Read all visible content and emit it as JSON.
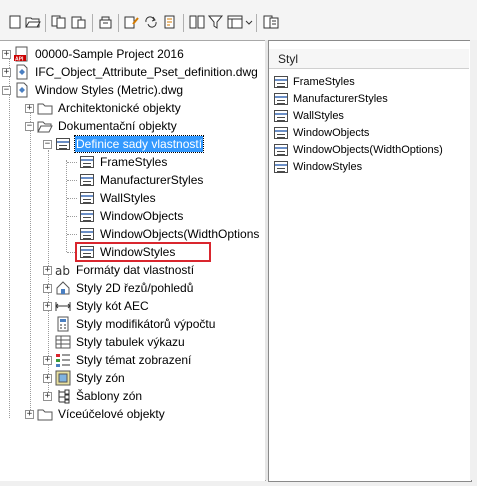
{
  "toolbar": {
    "buttons": [
      {
        "name": "new-document-icon",
        "glyph": "□"
      },
      {
        "name": "open-folder-icon",
        "glyph": "▱"
      },
      {
        "name": "copy-icon",
        "glyph": "❐"
      },
      {
        "name": "paste-icon",
        "glyph": "⎘"
      },
      {
        "name": "purge-icon",
        "glyph": "⚑"
      },
      {
        "name": "edit-style-icon",
        "glyph": "✎"
      },
      {
        "name": "synchronize-icon",
        "glyph": "↻"
      },
      {
        "name": "style-properties-icon",
        "glyph": "☰"
      },
      {
        "name": "compare-icon",
        "glyph": "▤"
      },
      {
        "name": "filter-icon",
        "glyph": "▽"
      },
      {
        "name": "view-options-icon",
        "glyph": "▦"
      },
      {
        "name": "toggle-view-icon",
        "glyph": "▣"
      }
    ]
  },
  "tree": {
    "nodes": [
      {
        "label": "00000-Sample Project 2016",
        "icon": "project-api-icon",
        "level": 0
      },
      {
        "label": "IFC_Object_Attribute_Pset_definition.dwg",
        "icon": "drawing-file-icon",
        "level": 0
      },
      {
        "label": "Window Styles (Metric).dwg",
        "icon": "drawing-file-icon",
        "level": 0
      },
      {
        "label": "Architektonické objekty",
        "icon": "folder-icon",
        "level": 1
      },
      {
        "label": "Dokumentační objekty",
        "icon": "folder-open-icon",
        "level": 1
      },
      {
        "label": "Definice sady vlastností",
        "icon": "table-icon",
        "level": 2,
        "selected": true
      },
      {
        "label": "FrameStyles",
        "icon": "table-icon",
        "level": 3
      },
      {
        "label": "ManufacturerStyles",
        "icon": "table-icon",
        "level": 3
      },
      {
        "label": "WallStyles",
        "icon": "table-icon",
        "level": 3
      },
      {
        "label": "WindowObjects",
        "icon": "table-icon",
        "level": 3
      },
      {
        "label": "WindowObjects(WidthOptions",
        "icon": "table-icon",
        "level": 3
      },
      {
        "label": "WindowStyles",
        "icon": "table-icon",
        "level": 3
      },
      {
        "label": "Formáty dat vlastností",
        "icon": "ab-format-icon",
        "level": 2
      },
      {
        "label": "Styly 2D řezů/pohledů",
        "icon": "section-house-icon",
        "level": 2
      },
      {
        "label": "Styly kót AEC",
        "icon": "dimension-icon",
        "level": 2
      },
      {
        "label": "Styly modifikátorů výpočtu",
        "icon": "calc-modifier-icon",
        "level": 2
      },
      {
        "label": "Styly tabulek výkazu",
        "icon": "schedule-table-icon",
        "level": 2
      },
      {
        "label": "Styly témat zobrazení",
        "icon": "display-theme-icon",
        "level": 2
      },
      {
        "label": "Styly zón",
        "icon": "zone-icon",
        "level": 2
      },
      {
        "label": "Šablony zón",
        "icon": "zone-template-icon",
        "level": 2
      },
      {
        "label": "Víceúčelové objekty",
        "icon": "folder-icon",
        "level": 1
      }
    ]
  },
  "list": {
    "column_header": "Styl",
    "rows": [
      "FrameStyles",
      "ManufacturerStyles",
      "WallStyles",
      "WindowObjects",
      "WindowObjects(WidthOptions)",
      "WindowStyles"
    ]
  },
  "colors": {
    "selection": "#3399ff",
    "highlight_box": "#d9262e"
  }
}
